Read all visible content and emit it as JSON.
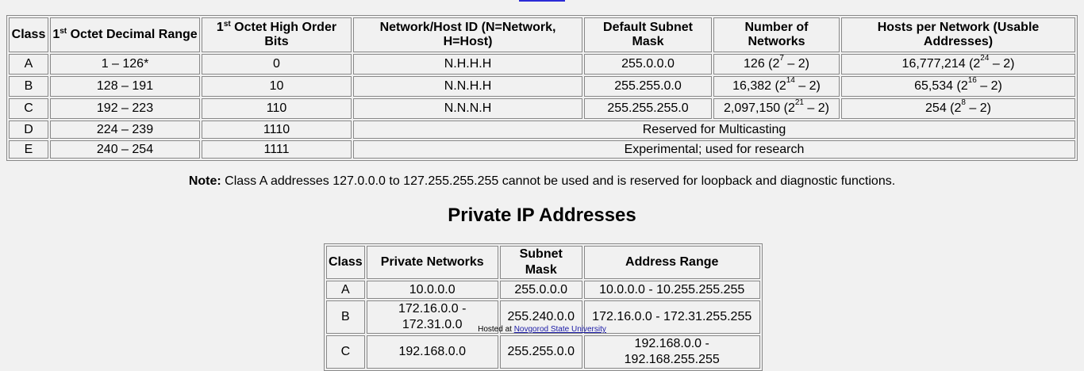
{
  "main_table": {
    "headers": {
      "class": "Class",
      "range_pre": "1",
      "range_sup": "st",
      "range_post": " Octet Decimal Range",
      "bits_pre": "1",
      "bits_sup": "st",
      "bits_post": " Octet High Order Bits",
      "nethost": "Network/Host ID (N=Network, H=Host)",
      "mask": "Default Subnet Mask",
      "networks": "Number of Networks",
      "hosts": "Hosts per Network (Usable Addresses)"
    },
    "rows": [
      {
        "class": "A",
        "range": "1 – 126*",
        "bits": "0",
        "nethost": "N.H.H.H",
        "mask": "255.0.0.0",
        "networks_pre": "126 (2",
        "networks_sup": "7",
        "networks_post": " – 2)",
        "hosts_pre": "16,777,214 (2",
        "hosts_sup": "24",
        "hosts_post": " – 2)"
      },
      {
        "class": "B",
        "range": "128 – 191",
        "bits": "10",
        "nethost": "N.N.H.H",
        "mask": "255.255.0.0",
        "networks_pre": "16,382 (2",
        "networks_sup": "14",
        "networks_post": " – 2)",
        "hosts_pre": "65,534 (2",
        "hosts_sup": "16",
        "hosts_post": " – 2)"
      },
      {
        "class": "C",
        "range": "192 – 223",
        "bits": "110",
        "nethost": "N.N.N.H",
        "mask": "255.255.255.0",
        "networks_pre": "2,097,150 (2",
        "networks_sup": "21",
        "networks_post": " – 2)",
        "hosts_pre": "254 (2",
        "hosts_sup": "8",
        "hosts_post": " – 2)"
      },
      {
        "class": "D",
        "range": "224 – 239",
        "bits": "1110",
        "span_text": "Reserved for Multicasting"
      },
      {
        "class": "E",
        "range": "240 – 254",
        "bits": "1111",
        "span_text": "Experimental; used for research"
      }
    ]
  },
  "note": {
    "label": "Note:",
    "text": " Class A addresses 127.0.0.0 to 127.255.255.255 cannot be used and is reserved for loopback and diagnostic functions."
  },
  "private_section": {
    "title": "Private IP Addresses",
    "headers": {
      "class": "Class",
      "networks": "Private Networks",
      "mask": "Subnet Mask",
      "range": "Address Range"
    },
    "rows": [
      {
        "class": "A",
        "networks": "10.0.0.0",
        "mask": "255.0.0.0",
        "range": "10.0.0.0 - 10.255.255.255"
      },
      {
        "class": "B",
        "networks": "172.16.0.0 - 172.31.0.0",
        "mask": "255.240.0.0",
        "range": "172.16.0.0 - 172.31.255.255"
      },
      {
        "class": "C",
        "networks": "192.168.0.0",
        "mask": "255.255.0.0",
        "range": "192.168.0.0 - 192.168.255.255"
      }
    ]
  },
  "footer": {
    "prefix": "Hosted at ",
    "link": "Novgorod State University"
  }
}
